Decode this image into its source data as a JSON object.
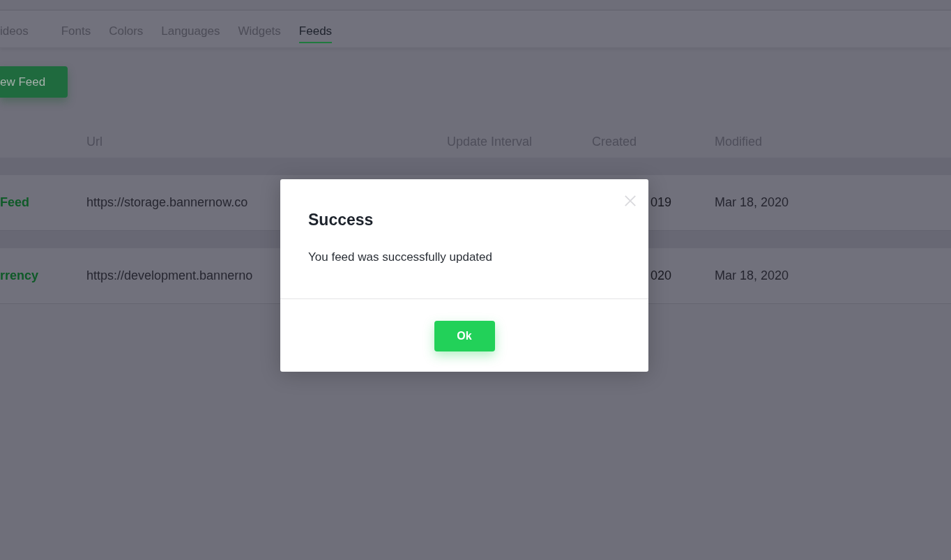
{
  "tabs": [
    {
      "label": "ideos",
      "selected": false
    },
    {
      "label": "Fonts",
      "selected": false
    },
    {
      "label": "Colors",
      "selected": false
    },
    {
      "label": "Languages",
      "selected": false
    },
    {
      "label": "Widgets",
      "selected": false
    },
    {
      "label": "Feeds",
      "selected": true
    }
  ],
  "new_feed_button": "ew Feed",
  "table": {
    "columns": [
      "Url",
      "Update Interval",
      "Created",
      "Modified"
    ],
    "rows": [
      {
        "name": "Feed",
        "url": "https://storage.bannernow.co",
        "created": "019",
        "modified": "Mar 18, 2020"
      },
      {
        "name": "rrency",
        "url": "https://development.bannerno",
        "created": "020",
        "modified": "Mar 18, 2020"
      }
    ]
  },
  "dialog": {
    "title": "Success",
    "message": "You feed was successfully updated",
    "ok_button": "Ok"
  }
}
